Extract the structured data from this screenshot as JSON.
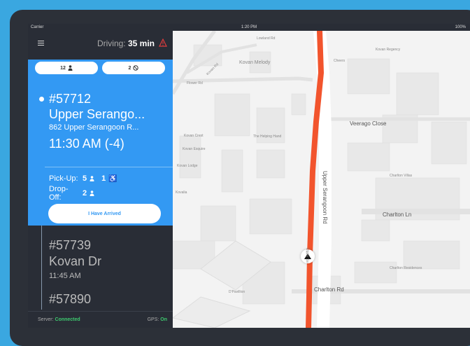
{
  "status_bar": {
    "carrier": "Carrier",
    "time": "1:20 PM",
    "battery": "100%"
  },
  "header": {
    "driving_label": "Driving:",
    "driving_value": "35 min"
  },
  "filters": [
    {
      "count": "12",
      "icon": "person-icon"
    },
    {
      "count": "2",
      "icon": "no-entry-icon"
    }
  ],
  "active_stop": {
    "id": "#57712",
    "name": "Upper Serango...",
    "address": "862 Upper Serangoon R...",
    "time": "11:30 AM  (-4)",
    "pickup_label": "Pick-Up:",
    "pickup_count": "5",
    "pickup_wheelchair": "1",
    "dropoff_label": "Drop-Off:",
    "dropoff_count": "2",
    "arrived_button": "I Have Arrived"
  },
  "upcoming_stops": [
    {
      "id": "#57739",
      "name": "Kovan Dr",
      "time": "11:45 AM"
    },
    {
      "id": "#57890"
    }
  ],
  "footer": {
    "server_label": "Server:",
    "server_status": "Connected",
    "gps_label": "GPS:",
    "gps_status": "On"
  },
  "map": {
    "roads": [
      "Veerago Close",
      "Upper Serangoon Rd",
      "Charlton Ln",
      "Charlton Rd",
      "Kovan Rd",
      "Flower Rd",
      "Lowland Rd",
      "Upper Se"
    ],
    "places": [
      "Kovan Melody",
      "The Helping Hand",
      "Kovan Crest",
      "Kovan Esquire",
      "Kovan Lodge",
      "Kovalia",
      "Charlton Villas",
      "Charlton Residences",
      "D'Pavillion",
      "Kovan Melody",
      "Cheers",
      "Kovan Regency"
    ]
  },
  "colors": {
    "accent": "#3399f3",
    "sidebar": "#292d36",
    "route": "#f2542d",
    "connected": "#3ec96f",
    "alert": "#e03c3c"
  }
}
